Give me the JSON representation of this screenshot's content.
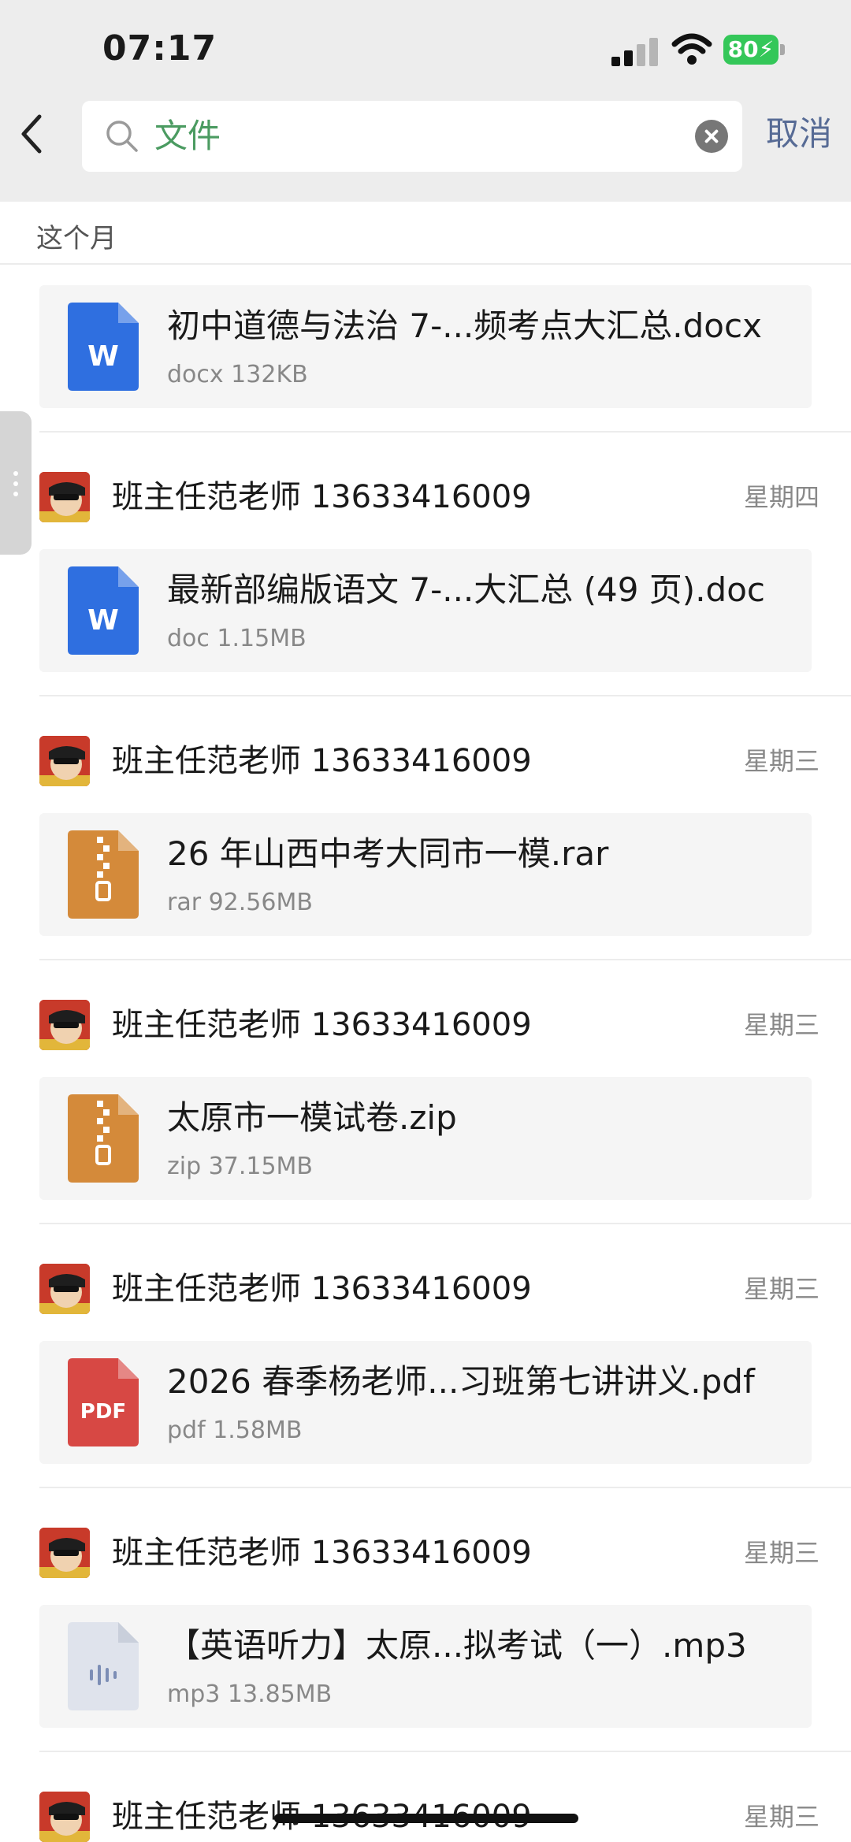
{
  "status_bar": {
    "time": "07:17",
    "battery": "80"
  },
  "search": {
    "value": "文件",
    "cancel_label": "取消"
  },
  "section": {
    "title": "这个月"
  },
  "colors": {
    "word": "#2f6fe0",
    "archive": "#d48a3a",
    "pdf": "#d74844",
    "audio": "#dfe3ec",
    "accent": "#4b9b61",
    "link": "#576b95"
  },
  "items": [
    {
      "sender": "",
      "date": "",
      "file_name": "初中道德与法治 7-...频考点大汇总.docx",
      "meta": "docx 132KB",
      "icon": "word-file-icon"
    },
    {
      "sender": "班主任范老师 13633416009",
      "date": "星期四",
      "file_name": "最新部编版语文 7-...大汇总 (49 页).doc",
      "meta": "doc 1.15MB",
      "icon": "word-file-icon"
    },
    {
      "sender": "班主任范老师 13633416009",
      "date": "星期三",
      "file_name": "26 年山西中考大同市一模.rar",
      "meta": "rar 92.56MB",
      "icon": "archive-file-icon"
    },
    {
      "sender": "班主任范老师 13633416009",
      "date": "星期三",
      "file_name": "太原市一模试卷.zip",
      "meta": "zip 37.15MB",
      "icon": "archive-file-icon"
    },
    {
      "sender": "班主任范老师 13633416009",
      "date": "星期三",
      "file_name": "2026 春季杨老师...习班第七讲讲义.pdf",
      "meta": "pdf 1.58MB",
      "icon": "pdf-file-icon",
      "icon_text": "PDF"
    },
    {
      "sender": "班主任范老师 13633416009",
      "date": "星期三",
      "file_name": "【英语听力】太原...拟考试（一）.mp3",
      "meta": "mp3 13.85MB",
      "icon": "audio-file-icon"
    },
    {
      "sender": "班主任范老师 13633416009",
      "date": "星期三"
    }
  ]
}
